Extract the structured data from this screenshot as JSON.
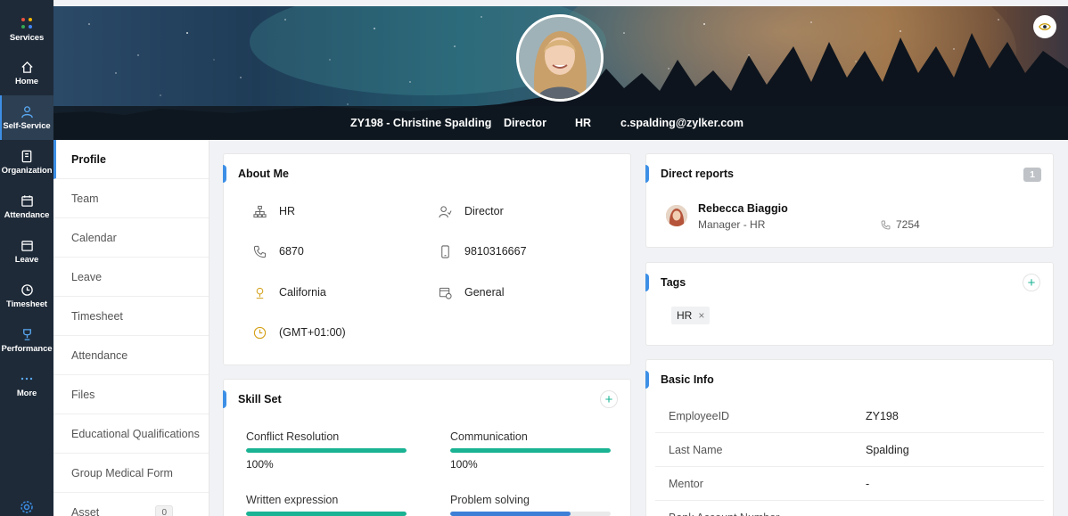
{
  "rail": {
    "items": [
      {
        "label": "Services",
        "icon": "grid-dots-icon"
      },
      {
        "label": "Home",
        "icon": "home-icon"
      },
      {
        "label": "Self-Service",
        "icon": "user-icon"
      },
      {
        "label": "Organization",
        "icon": "org-book-icon"
      },
      {
        "label": "Attendance",
        "icon": "calendar-check-icon"
      },
      {
        "label": "Leave",
        "icon": "calendar-icon"
      },
      {
        "label": "Timesheet",
        "icon": "clock-icon"
      },
      {
        "label": "Performance",
        "icon": "trophy-icon"
      },
      {
        "label": "More",
        "icon": "more-dots-icon"
      }
    ],
    "active": "Self-Service",
    "accent_color": "#3d8fe6"
  },
  "profile": {
    "id_name": "ZY198 - Christine Spalding",
    "designation": "Director",
    "department": "HR",
    "email": "c.spalding@zylker.com"
  },
  "subnav": {
    "items": [
      {
        "label": "Profile"
      },
      {
        "label": "Team"
      },
      {
        "label": "Calendar"
      },
      {
        "label": "Leave"
      },
      {
        "label": "Timesheet"
      },
      {
        "label": "Attendance"
      },
      {
        "label": "Files"
      },
      {
        "label": "Educational Qualifications"
      },
      {
        "label": "Group Medical Form"
      },
      {
        "label": "Asset",
        "count": "0"
      }
    ],
    "active": "Profile"
  },
  "about": {
    "title": "About Me",
    "department": "HR",
    "designation": "Director",
    "extension": "6870",
    "mobile": "9810316667",
    "location": "California",
    "shift": "General",
    "timezone": "(GMT+01:00)"
  },
  "skills": {
    "title": "Skill Set",
    "items": [
      {
        "name": "Conflict Resolution",
        "percent": 100,
        "percent_label": "100%",
        "color": "#1ab394"
      },
      {
        "name": "Communication",
        "percent": 100,
        "percent_label": "100%",
        "color": "#1ab394"
      },
      {
        "name": "Written expression",
        "percent": 100,
        "color": "#1ab394"
      },
      {
        "name": "Problem solving",
        "percent": 75,
        "color": "#3d7fd6"
      }
    ]
  },
  "direct_reports": {
    "title": "Direct reports",
    "count": "1",
    "items": [
      {
        "name": "Rebecca Biaggio",
        "role": "Manager - HR",
        "extension": "7254"
      }
    ]
  },
  "tags": {
    "title": "Tags",
    "items": [
      {
        "label": "HR"
      }
    ]
  },
  "basic_info": {
    "title": "Basic Info",
    "rows": [
      {
        "key": "EmployeeID",
        "value": "ZY198"
      },
      {
        "key": "Last Name",
        "value": "Spalding"
      },
      {
        "key": "Mentor",
        "value": "-"
      },
      {
        "key": "Bank Account Number",
        "value": ""
      }
    ]
  }
}
